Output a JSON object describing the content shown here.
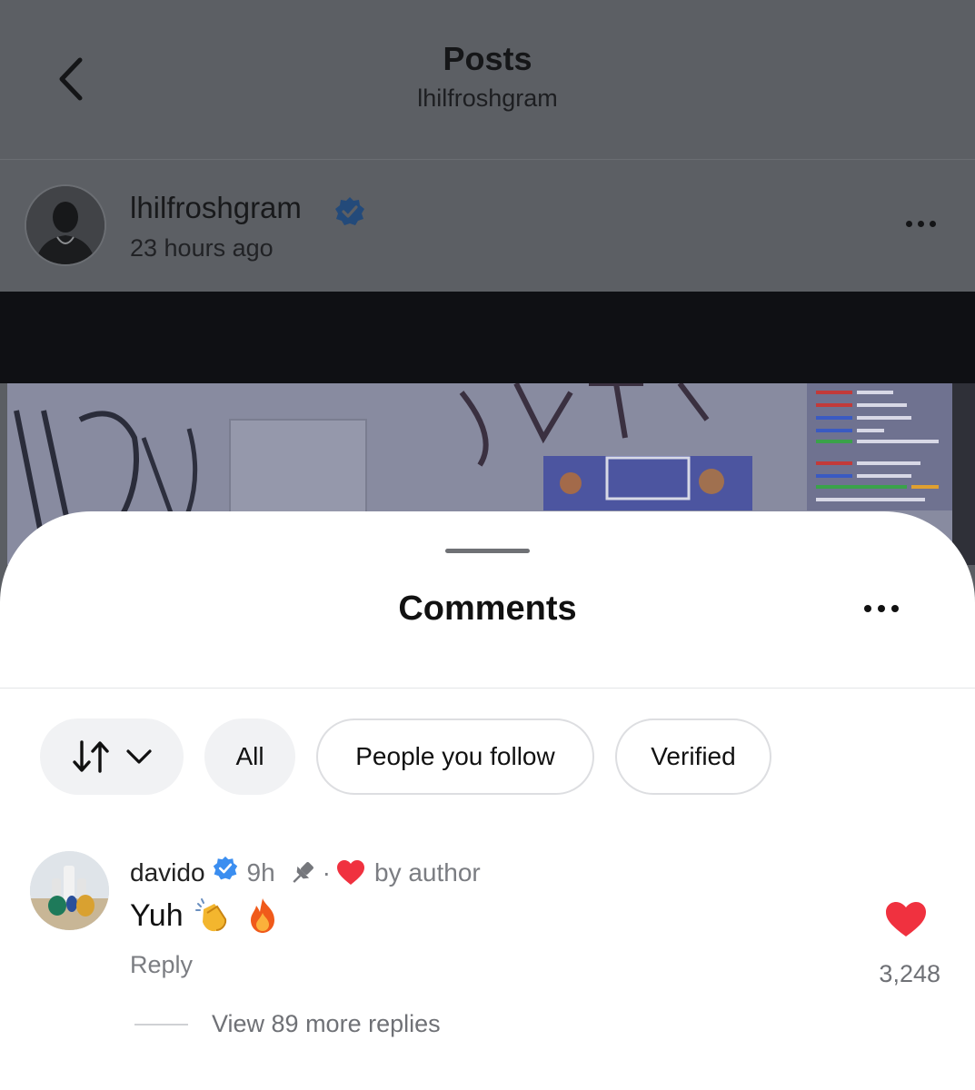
{
  "header": {
    "title": "Posts",
    "subtitle": "lhilfroshgram"
  },
  "post": {
    "username": "lhilfroshgram",
    "time": "23 hours ago"
  },
  "comments_sheet": {
    "title": "Comments",
    "filters": [
      "All",
      "People you follow",
      "Verified"
    ]
  },
  "comment": {
    "username": "davido",
    "time": "9h",
    "separator": "·",
    "liked_by": "by author",
    "text": "Yuh",
    "reply_label": "Reply",
    "likes": "3,248",
    "view_replies": "View 89 more replies"
  },
  "colors": {
    "verified": "#3b8ef0",
    "heart": "#f0313f",
    "sheet_bg": "#ffffff",
    "dimmed_bg": "#5c5f64"
  },
  "icons": [
    "back-chevron-icon",
    "verified-badge-icon",
    "more-dots-icon",
    "sort-arrows-icon",
    "chevron-down-icon",
    "pin-icon",
    "heart-icon",
    "clapping-hands-emoji",
    "fire-emoji"
  ]
}
